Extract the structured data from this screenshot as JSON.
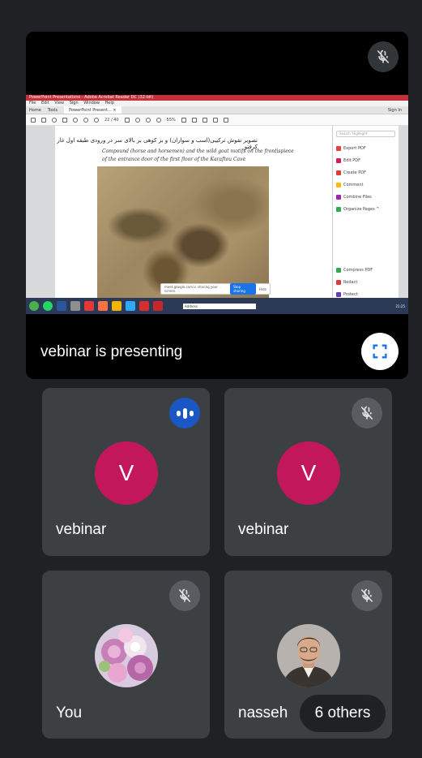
{
  "presentation": {
    "label": "vebinar is presenting",
    "mic_muted_icon": "mic-off-icon",
    "fullscreen_icon": "fullscreen-icon"
  },
  "shared_screen": {
    "window_title": "PowerPoint Presentations - Adobe Acrobat Reader DC (32-bit)",
    "menu": [
      "File",
      "Edit",
      "View",
      "Sign",
      "Window",
      "Help"
    ],
    "tabs": [
      "Home",
      "Tools",
      "PowerPoint Present... ×"
    ],
    "sign_in": "Sign In",
    "page_counter": "22 / 40",
    "zoom": "55%",
    "persian_caption": "تصویر نقوش ترکیبی(اسب و سواران) و بز کوهی بر بالای سر در ورودی طبقه اول غار کرفتو",
    "english_caption_line1": "Compound (horse and horsemen) and the wild goat motifs on the frontispiece",
    "english_caption_line2": "of the entrance door of the first floor of the Karaftou Cave",
    "search_placeholder": "Search 'Highlight'",
    "tools": [
      {
        "label": "Export PDF",
        "color": "#e0453c"
      },
      {
        "label": "Edit PDF",
        "color": "#d81b60"
      },
      {
        "label": "Create PDF",
        "color": "#e53935"
      },
      {
        "label": "Comment",
        "color": "#fbbc04"
      },
      {
        "label": "Combine Files",
        "color": "#9c27b0"
      },
      {
        "label": "Organize Pages ^",
        "color": "#34a853"
      }
    ],
    "tools_bottom": [
      {
        "label": "Compress PDF",
        "color": "#34a853"
      },
      {
        "label": "Redact",
        "color": "#e53935"
      },
      {
        "label": "Protect",
        "color": "#673ab7"
      }
    ],
    "share_notice": "meet.google.com is sharing your screen.",
    "stop_sharing": "Stop sharing",
    "hide": "Hide",
    "address_label": "Address",
    "clock": "21:25"
  },
  "participants": [
    {
      "name": "vebinar",
      "initial": "V",
      "status": "speaking",
      "avatar_color": "#c2185b"
    },
    {
      "name": "vebinar",
      "initial": "V",
      "status": "muted",
      "avatar_color": "#c2185b"
    },
    {
      "name": "You",
      "status": "muted",
      "avatar": "flowers-photo"
    },
    {
      "name": "nasseh",
      "status": "muted",
      "avatar": "person-photo"
    }
  ],
  "others_count_label": "6 others"
}
